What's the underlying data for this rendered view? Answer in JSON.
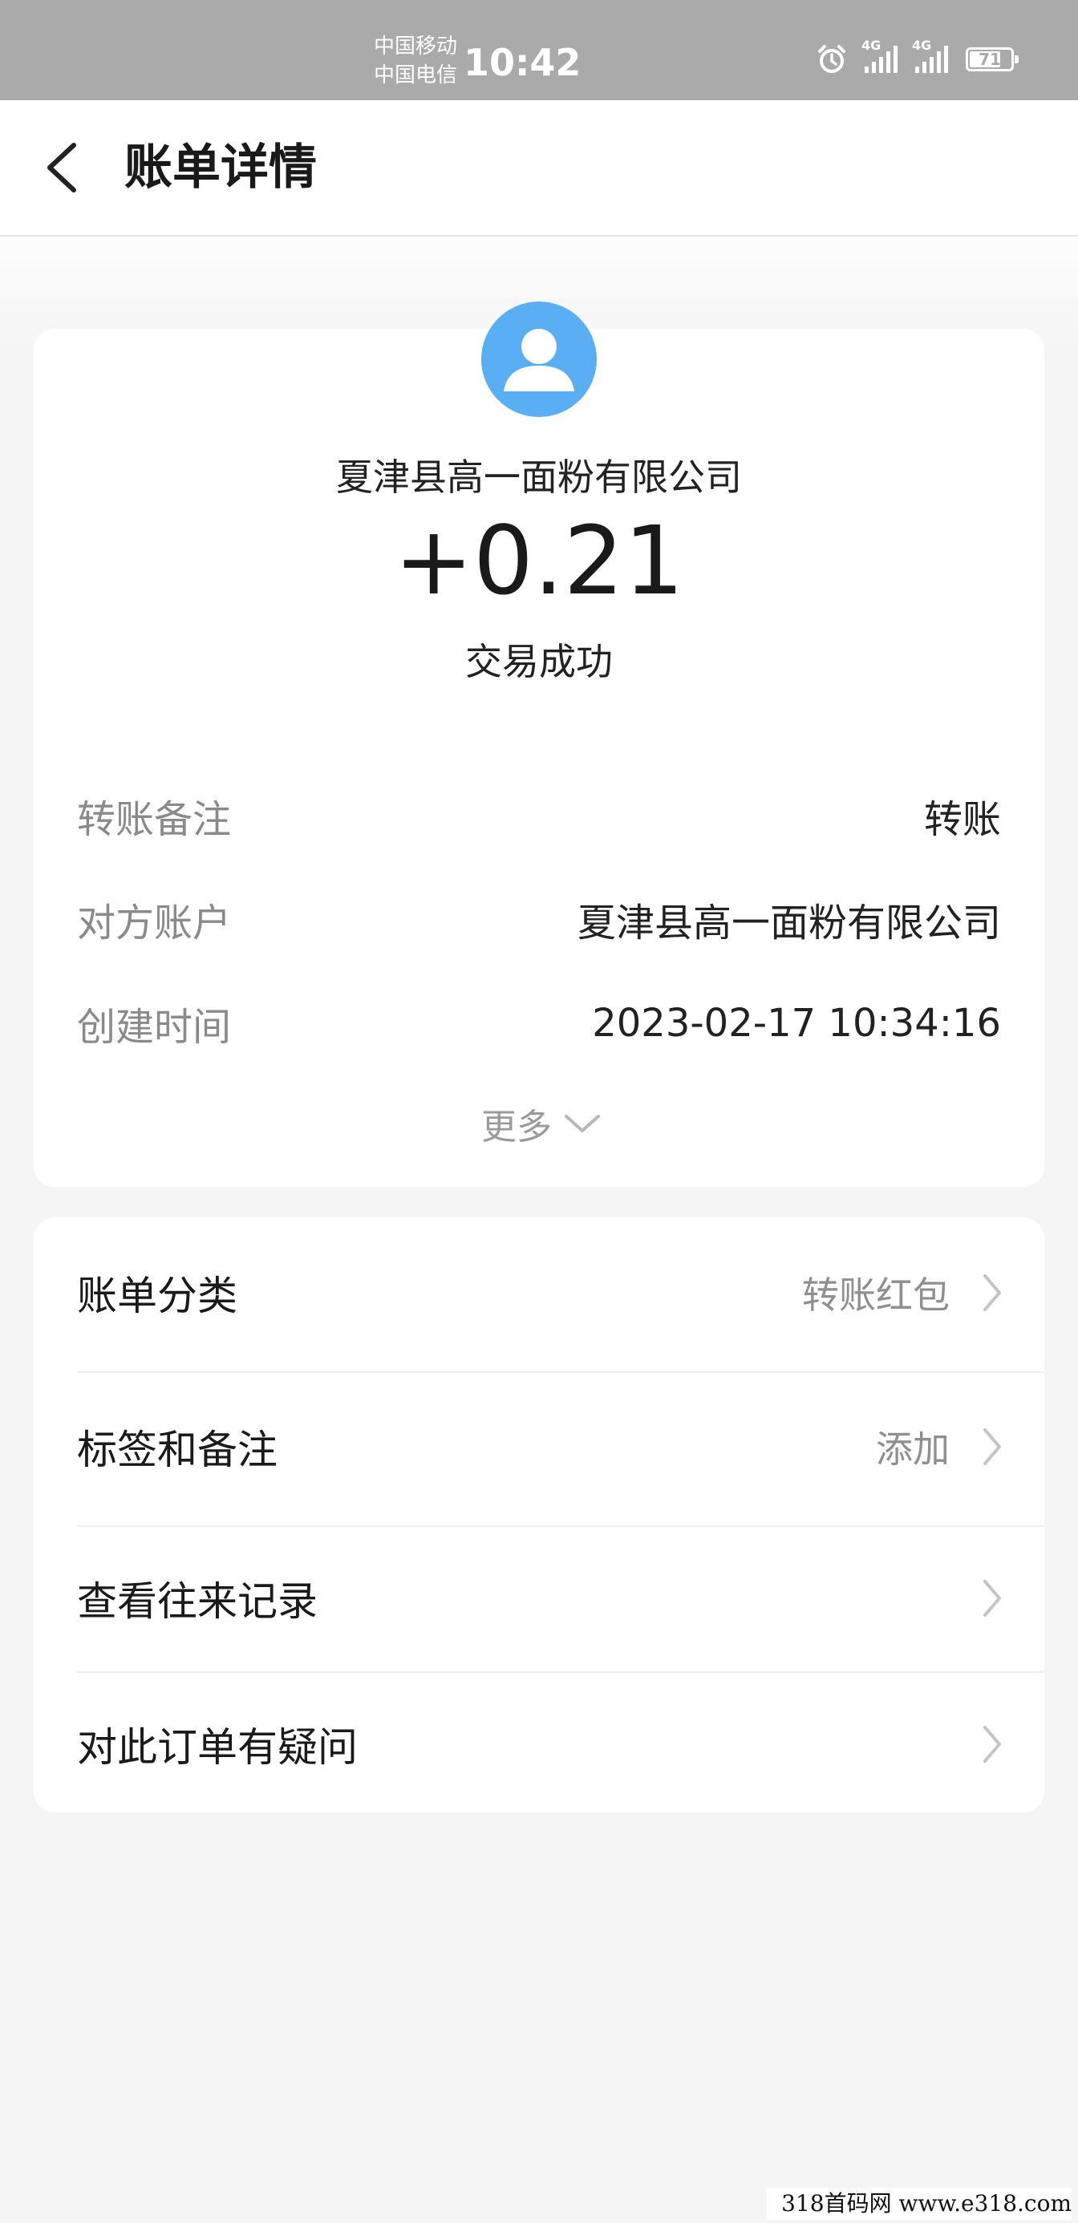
{
  "status_bar": {
    "carrier_1": "中国移动",
    "carrier_2": "中国电信",
    "time": "10:42",
    "net_1": "4G",
    "net_2": "4G",
    "battery": "71"
  },
  "nav": {
    "title": "账单详情"
  },
  "transaction": {
    "payer": "夏津县高一面粉有限公司",
    "amount": "+0.21",
    "status": "交易成功",
    "avatar_color": "#5aaef4"
  },
  "details": [
    {
      "label": "转账备注",
      "value": "转账"
    },
    {
      "label": "对方账户",
      "value": "夏津县高一面粉有限公司"
    },
    {
      "label": "创建时间",
      "value": "2023-02-17 10:34:16"
    }
  ],
  "more_label": "更多",
  "actions": [
    {
      "label": "账单分类",
      "value": "转账红包"
    },
    {
      "label": "标签和备注",
      "value": "添加"
    },
    {
      "label": "查看往来记录",
      "value": ""
    },
    {
      "label": "对此订单有疑问",
      "value": ""
    }
  ],
  "watermark": "318首码网  www.e318.com"
}
